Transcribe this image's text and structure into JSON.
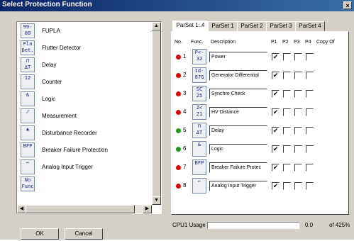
{
  "window": {
    "title": "Select Protection Function",
    "close_glyph": "×"
  },
  "function_list": {
    "items": [
      {
        "icon_text": "99-\n00",
        "icon": "fupla-icon",
        "label": "FUPLA"
      },
      {
        "icon_text": "Fla\nDet.",
        "icon": "flutter-detector-icon",
        "label": "Flutter Detector"
      },
      {
        "icon_text": "⊓\nΔT",
        "icon": "delay-icon",
        "label": "Delay"
      },
      {
        "icon_text": "12",
        "icon": "counter-icon",
        "label": "Counter"
      },
      {
        "icon_text": "&",
        "icon": "logic-icon",
        "label": "Logic"
      },
      {
        "icon_text": "⁄⁄",
        "icon": "measurement-icon",
        "label": "Measurement"
      },
      {
        "icon_text": "▲",
        "icon": "disturbance-recorder-icon",
        "label": "Disturbance Recorder"
      },
      {
        "icon_text": "BFP",
        "icon": "breaker-failure-icon",
        "label": "Breaker Failure Protection"
      },
      {
        "icon_text": "⌐",
        "icon": "analog-input-trigger-icon",
        "label": "Analog Input Trigger"
      },
      {
        "icon_text": "No\nFunc",
        "icon": "no-function-icon",
        "label": ""
      }
    ],
    "scroll_up": "▲",
    "scroll_down": "▼",
    "scroll_left": "◀",
    "scroll_right": "▶"
  },
  "buttons": {
    "ok": "OK",
    "cancel": "Cancel"
  },
  "tabs": [
    {
      "label": "ParSet 1..4",
      "active": true
    },
    {
      "label": "ParSet 1",
      "active": false
    },
    {
      "label": "ParSet 2",
      "active": false
    },
    {
      "label": "ParSet 3",
      "active": false
    },
    {
      "label": "ParSet 4",
      "active": false
    }
  ],
  "table": {
    "headers": {
      "no": "No.",
      "func": "Func.",
      "description": "Description",
      "p1": "P1",
      "p2": "P2",
      "p3": "P3",
      "p4": "P4",
      "copy": "Copy Of"
    },
    "rows": [
      {
        "no": "1",
        "status": "red",
        "icon_text": "P<-\n32",
        "icon": "power-icon",
        "description": "Power",
        "p1": true,
        "p2": false,
        "p3": false,
        "p4": false
      },
      {
        "no": "2",
        "status": "red",
        "icon_text": "Id-\n87G",
        "icon": "generator-differential-icon",
        "description": "Generator Differential",
        "p1": true,
        "p2": false,
        "p3": false,
        "p4": false
      },
      {
        "no": "3",
        "status": "red",
        "icon_text": "SC\n25",
        "icon": "synchro-check-icon",
        "description": "Synchro Check",
        "p1": true,
        "p2": false,
        "p3": false,
        "p4": false
      },
      {
        "no": "4",
        "status": "red",
        "icon_text": "Z<\n21",
        "icon": "hv-distance-icon",
        "description": "HV Distance",
        "p1": true,
        "p2": false,
        "p3": false,
        "p4": false
      },
      {
        "no": "5",
        "status": "green",
        "icon_text": "⊓\nΔT",
        "icon": "delay-icon",
        "description": "Delay",
        "p1": true,
        "p2": false,
        "p3": false,
        "p4": false
      },
      {
        "no": "6",
        "status": "green",
        "icon_text": "&",
        "icon": "logic-icon",
        "description": "Logic",
        "p1": true,
        "p2": false,
        "p3": false,
        "p4": false
      },
      {
        "no": "7",
        "status": "red",
        "icon_text": "BFP",
        "icon": "breaker-failure-icon",
        "description": "Breaker Failure Protec",
        "p1": true,
        "p2": false,
        "p3": false,
        "p4": false
      },
      {
        "no": "8",
        "status": "red",
        "icon_text": "⌐",
        "icon": "analog-input-trigger-icon",
        "description": "Analog Input Trigger",
        "p1": true,
        "p2": false,
        "p3": false,
        "p4": false
      }
    ],
    "check_glyph": "✔"
  },
  "cpu": {
    "label": "CPU1 Usage",
    "value": "0.0",
    "max": "of 425%",
    "usage_fraction": 0.0
  },
  "colors": {
    "status_red": "#e00000",
    "status_green": "#1a9e1a",
    "title_bar": "#0a246a"
  }
}
